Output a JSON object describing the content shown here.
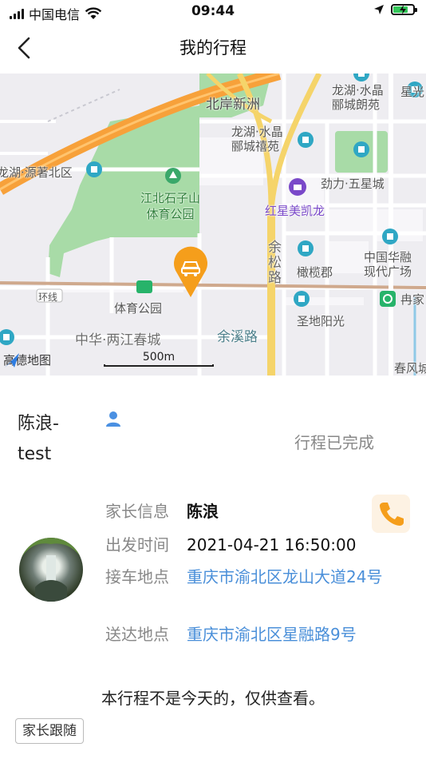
{
  "status_bar": {
    "carrier": "中国电信",
    "time": "09:44",
    "icons": [
      "signal-icon",
      "wifi-icon",
      "location-arrow-icon",
      "battery-charging-icon"
    ]
  },
  "nav": {
    "title": "我的行程",
    "back_icon": "chevron-left-icon"
  },
  "map": {
    "labels": {
      "beian_xinzhou": "北岸新洲",
      "longhu_shuijing_langyuan": "龙湖·水晶\n郦城朗苑",
      "xingguang": "星光",
      "longhu_shuijing_xiyuan": "龙湖·水晶\n郦城禧苑",
      "yuanshu_beiqu": "龙湖·源著北区",
      "jiangbei_park": "江北石子山\n体育公园",
      "jinli_wuxingcheng": "劲力·五星城",
      "hongxing_meikailong": "红星美凯龙",
      "yusong_road": "余松路",
      "ganlanjun": "橄榄郡",
      "zhonghua_plaza": "中国华融\n现代广场",
      "huanxian": "环线",
      "tiyu_gongyuan": "体育公园",
      "ranjia": "冉家",
      "zhonghua_liangjiang": "中华·两江春城",
      "yuxi_road": "余溪路",
      "shengdi_yangguang": "圣地阳光",
      "chunfeng": "春风城",
      "amap_logo": "高德地图",
      "scale": "500m"
    },
    "colors": {
      "background": "#eeedf1",
      "park": "#a8dba7",
      "expressway": "#f7a13a",
      "main_road": "#f5d46a",
      "metro_line": "#cfa98d",
      "marker": "#f59e1b",
      "poi": "#2fa7c4"
    }
  },
  "trip": {
    "name": "陈浪-test",
    "status": "行程已完成",
    "rows": [
      {
        "label": "家长信息",
        "value": "陈浪"
      },
      {
        "label": "出发时间",
        "value": "2021-04-21 16:50:00"
      },
      {
        "label": "接车地点",
        "value": "重庆市渝北区龙山大道24号"
      },
      {
        "label": "送达地点",
        "value": "重庆市渝北区星融路9号"
      }
    ],
    "call_icon": "phone-icon",
    "notice": "本行程不是今天的，仅供查看。",
    "follow_button": "家长跟随"
  }
}
